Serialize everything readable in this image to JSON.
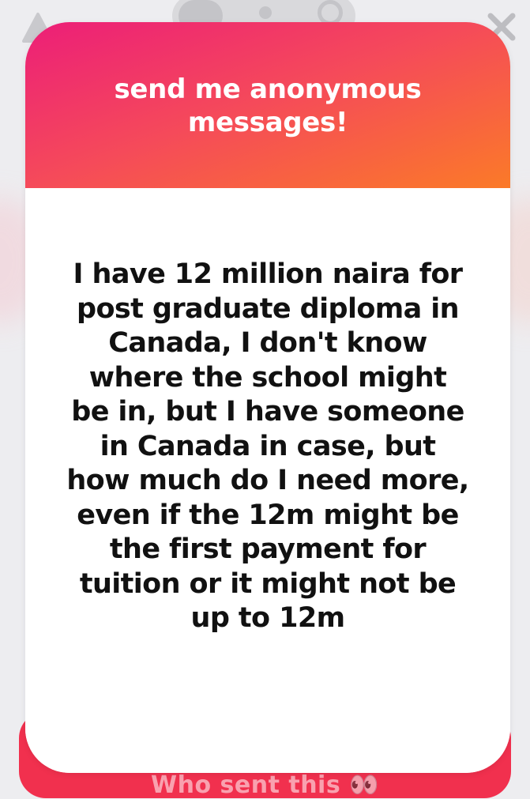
{
  "header": {
    "title": "send me anonymous messages!"
  },
  "message": {
    "text": "I have 12 million naira for post graduate diploma in Canada, I don't know where the school might be in, but I have someone in Canada in case, but how much do I need more, even if the 12m might be the first payment for tuition or it might not be up to 12m"
  },
  "footer": {
    "who_sent_label": "Who sent this 👀"
  },
  "colors": {
    "gradient_start": "#ec1e78",
    "gradient_end": "#fb7a28",
    "button_red": "#f1304e"
  },
  "icons": [
    "warning-icon",
    "camera-icon",
    "close-icon"
  ]
}
